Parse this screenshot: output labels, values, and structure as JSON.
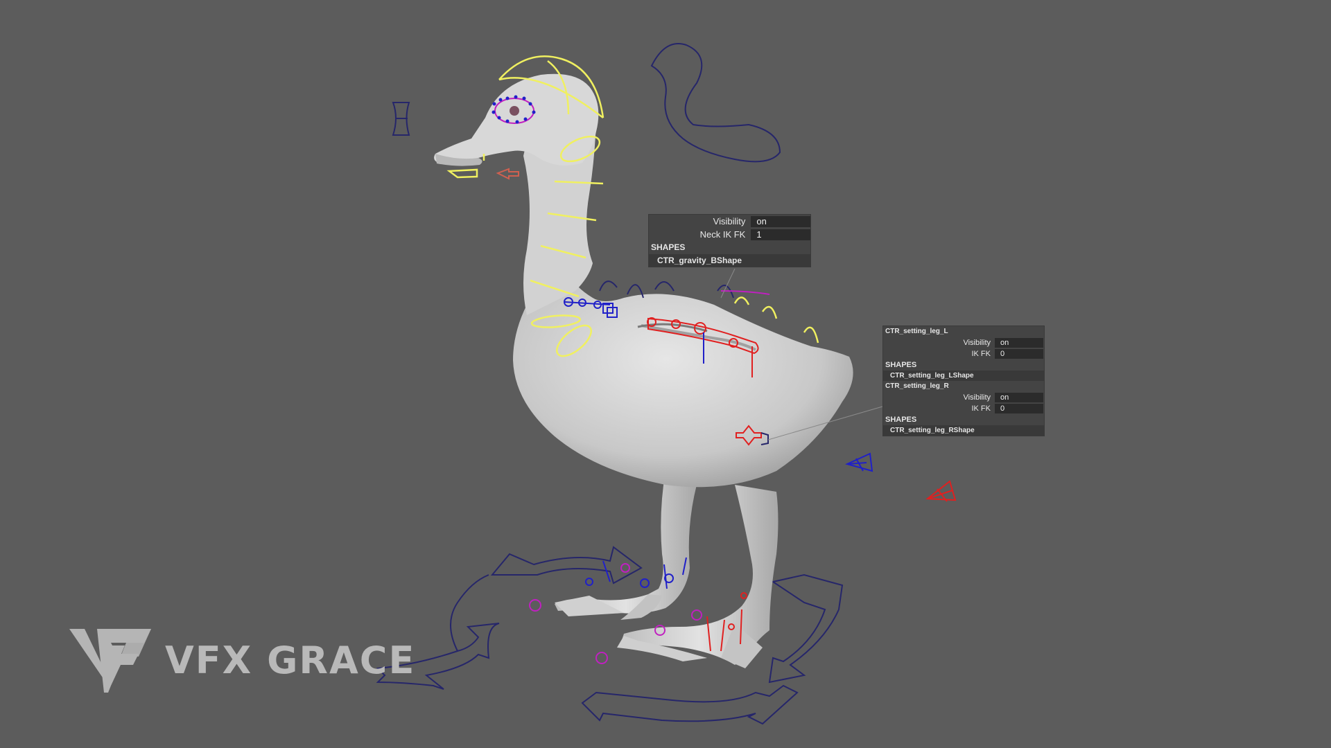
{
  "viewport": {
    "background": "#5c5c5c",
    "model": "duck rig",
    "colors": {
      "mesh": "#d8d8d8",
      "yellow_ctrl": "#f0f060",
      "blue_ctrl": "#2020c8",
      "red_ctrl": "#e02020",
      "magenta_ctrl": "#c020c0",
      "dark_ctrl": "#26266a"
    }
  },
  "hud_neck": {
    "rows": [
      {
        "label": "Visibility",
        "value": "on"
      },
      {
        "label": "Neck IK FK",
        "value": "1"
      }
    ],
    "shapes_header": "SHAPES",
    "shape_name": "CTR_gravity_BShape"
  },
  "hud_legs": {
    "node_l": "CTR_setting_leg_L",
    "rows_l": [
      {
        "label": "Visibility",
        "value": "on"
      },
      {
        "label": "IK FK",
        "value": "0"
      }
    ],
    "shapes_header_l": "SHAPES",
    "shape_l": "CTR_setting_leg_LShape",
    "node_r": "CTR_setting_leg_R",
    "rows_r": [
      {
        "label": "Visibility",
        "value": "on"
      },
      {
        "label": "IK FK",
        "value": "0"
      }
    ],
    "shapes_header_r": "SHAPES",
    "shape_r": "CTR_setting_leg_RShape"
  },
  "watermark": {
    "text": "VFX GRACE",
    "icon": "vg-logo-icon"
  }
}
